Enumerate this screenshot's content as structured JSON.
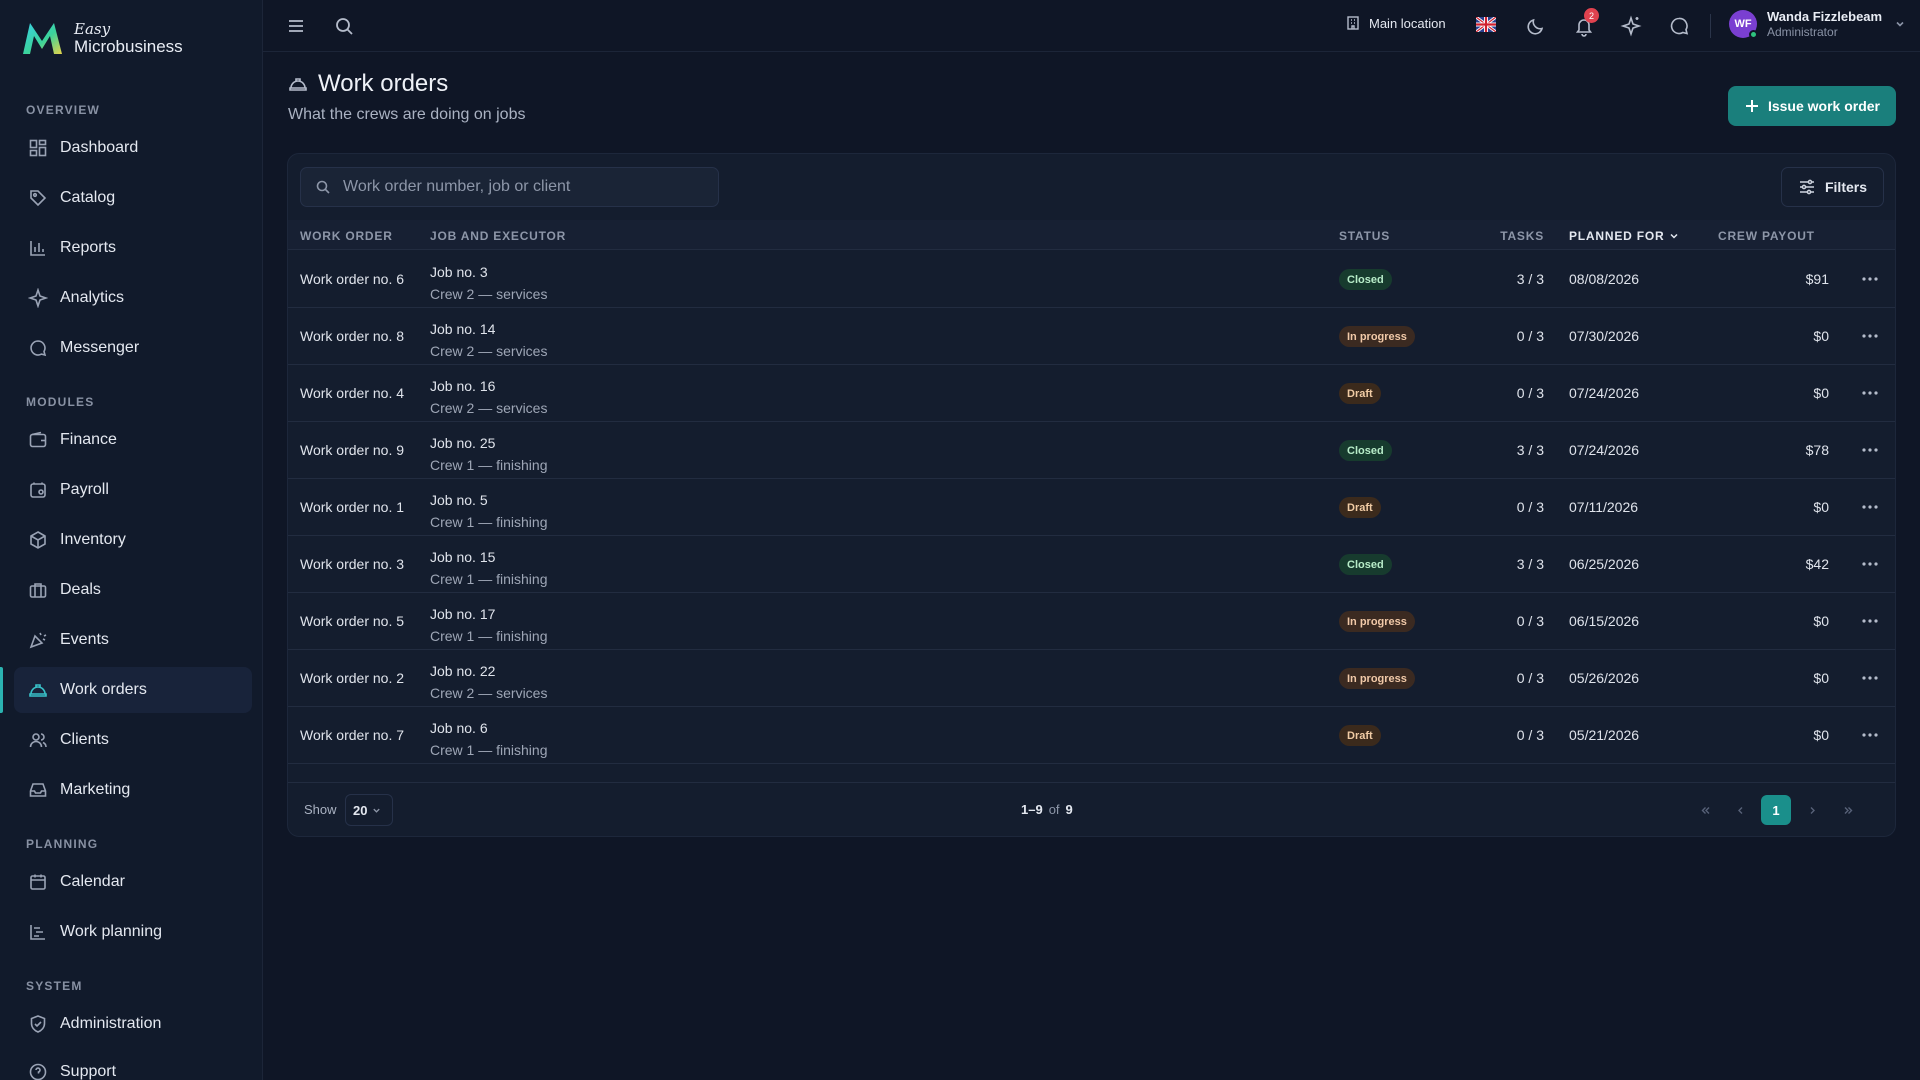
{
  "brand": {
    "easy": "Easy",
    "name": "Microbusiness"
  },
  "sidebar": {
    "sections": [
      {
        "label": "OVERVIEW"
      },
      {
        "label": "MODULES"
      },
      {
        "label": "PLANNING"
      },
      {
        "label": "SYSTEM"
      }
    ],
    "items": [
      {
        "label": "Dashboard",
        "icon": "dashboard-icon"
      },
      {
        "label": "Catalog",
        "icon": "tag-icon"
      },
      {
        "label": "Reports",
        "icon": "bar-chart-icon"
      },
      {
        "label": "Analytics",
        "icon": "sparkle-icon"
      },
      {
        "label": "Messenger",
        "icon": "chat-icon"
      },
      {
        "label": "Finance",
        "icon": "wallet-icon"
      },
      {
        "label": "Payroll",
        "icon": "payroll-icon"
      },
      {
        "label": "Inventory",
        "icon": "box-icon"
      },
      {
        "label": "Deals",
        "icon": "briefcase-icon"
      },
      {
        "label": "Events",
        "icon": "party-icon"
      },
      {
        "label": "Work orders",
        "icon": "hard-hat-icon",
        "active": true
      },
      {
        "label": "Clients",
        "icon": "users-icon"
      },
      {
        "label": "Marketing",
        "icon": "inbox-icon"
      },
      {
        "label": "Calendar",
        "icon": "calendar-icon"
      },
      {
        "label": "Work planning",
        "icon": "gantt-icon"
      },
      {
        "label": "Administration",
        "icon": "shield-icon"
      },
      {
        "label": "Support",
        "icon": "help-icon"
      }
    ]
  },
  "topbar": {
    "location": "Main location",
    "notifications_count": "2",
    "user": {
      "initials": "WF",
      "name": "Wanda Fizzlebeam",
      "role": "Administrator"
    }
  },
  "page": {
    "title": "Work orders",
    "subtitle": "What the crews are doing on jobs",
    "issue_button": "Issue work order"
  },
  "toolbar": {
    "search_placeholder": "Work order number, job or client",
    "filters_label": "Filters"
  },
  "table": {
    "headers": {
      "work_order": "WORK ORDER",
      "job_executor": "JOB AND EXECUTOR",
      "status": "STATUS",
      "tasks": "TASKS",
      "planned_for": "PLANNED FOR",
      "crew_payout": "CREW PAYOUT"
    },
    "rows": [
      {
        "wo": "Work order no. 6",
        "job": "Job no. 3",
        "crew": "Crew 2 — services",
        "status": "Closed",
        "status_kind": "closed",
        "tasks": "3 / 3",
        "date": "08/08/2026",
        "payout": "$91"
      },
      {
        "wo": "Work order no. 8",
        "job": "Job no. 14",
        "crew": "Crew 2 — services",
        "status": "In progress",
        "status_kind": "inprogress",
        "tasks": "0 / 3",
        "date": "07/30/2026",
        "payout": "$0"
      },
      {
        "wo": "Work order no. 4",
        "job": "Job no. 16",
        "crew": "Crew 2 — services",
        "status": "Draft",
        "status_kind": "draft",
        "tasks": "0 / 3",
        "date": "07/24/2026",
        "payout": "$0"
      },
      {
        "wo": "Work order no. 9",
        "job": "Job no. 25",
        "crew": "Crew 1 — finishing",
        "status": "Closed",
        "status_kind": "closed",
        "tasks": "3 / 3",
        "date": "07/24/2026",
        "payout": "$78"
      },
      {
        "wo": "Work order no. 1",
        "job": "Job no. 5",
        "crew": "Crew 1 — finishing",
        "status": "Draft",
        "status_kind": "draft",
        "tasks": "0 / 3",
        "date": "07/11/2026",
        "payout": "$0"
      },
      {
        "wo": "Work order no. 3",
        "job": "Job no. 15",
        "crew": "Crew 1 — finishing",
        "status": "Closed",
        "status_kind": "closed",
        "tasks": "3 / 3",
        "date": "06/25/2026",
        "payout": "$42"
      },
      {
        "wo": "Work order no. 5",
        "job": "Job no. 17",
        "crew": "Crew 1 — finishing",
        "status": "In progress",
        "status_kind": "inprogress",
        "tasks": "0 / 3",
        "date": "06/15/2026",
        "payout": "$0"
      },
      {
        "wo": "Work order no. 2",
        "job": "Job no. 22",
        "crew": "Crew 2 — services",
        "status": "In progress",
        "status_kind": "inprogress",
        "tasks": "0 / 3",
        "date": "05/26/2026",
        "payout": "$0"
      },
      {
        "wo": "Work order no. 7",
        "job": "Job no. 6",
        "crew": "Crew 1 — finishing",
        "status": "Draft",
        "status_kind": "draft",
        "tasks": "0 / 3",
        "date": "05/21/2026",
        "payout": "$0"
      }
    ]
  },
  "pagination": {
    "show_label": "Show",
    "page_size": "20",
    "range": "1–9",
    "of": "of",
    "total": "9",
    "current_page": "1"
  },
  "colors": {
    "accent": "#1a8f8b",
    "closed": "#b7ecc8",
    "in_progress": "#f1c9a8",
    "draft": "#f0cba4"
  }
}
